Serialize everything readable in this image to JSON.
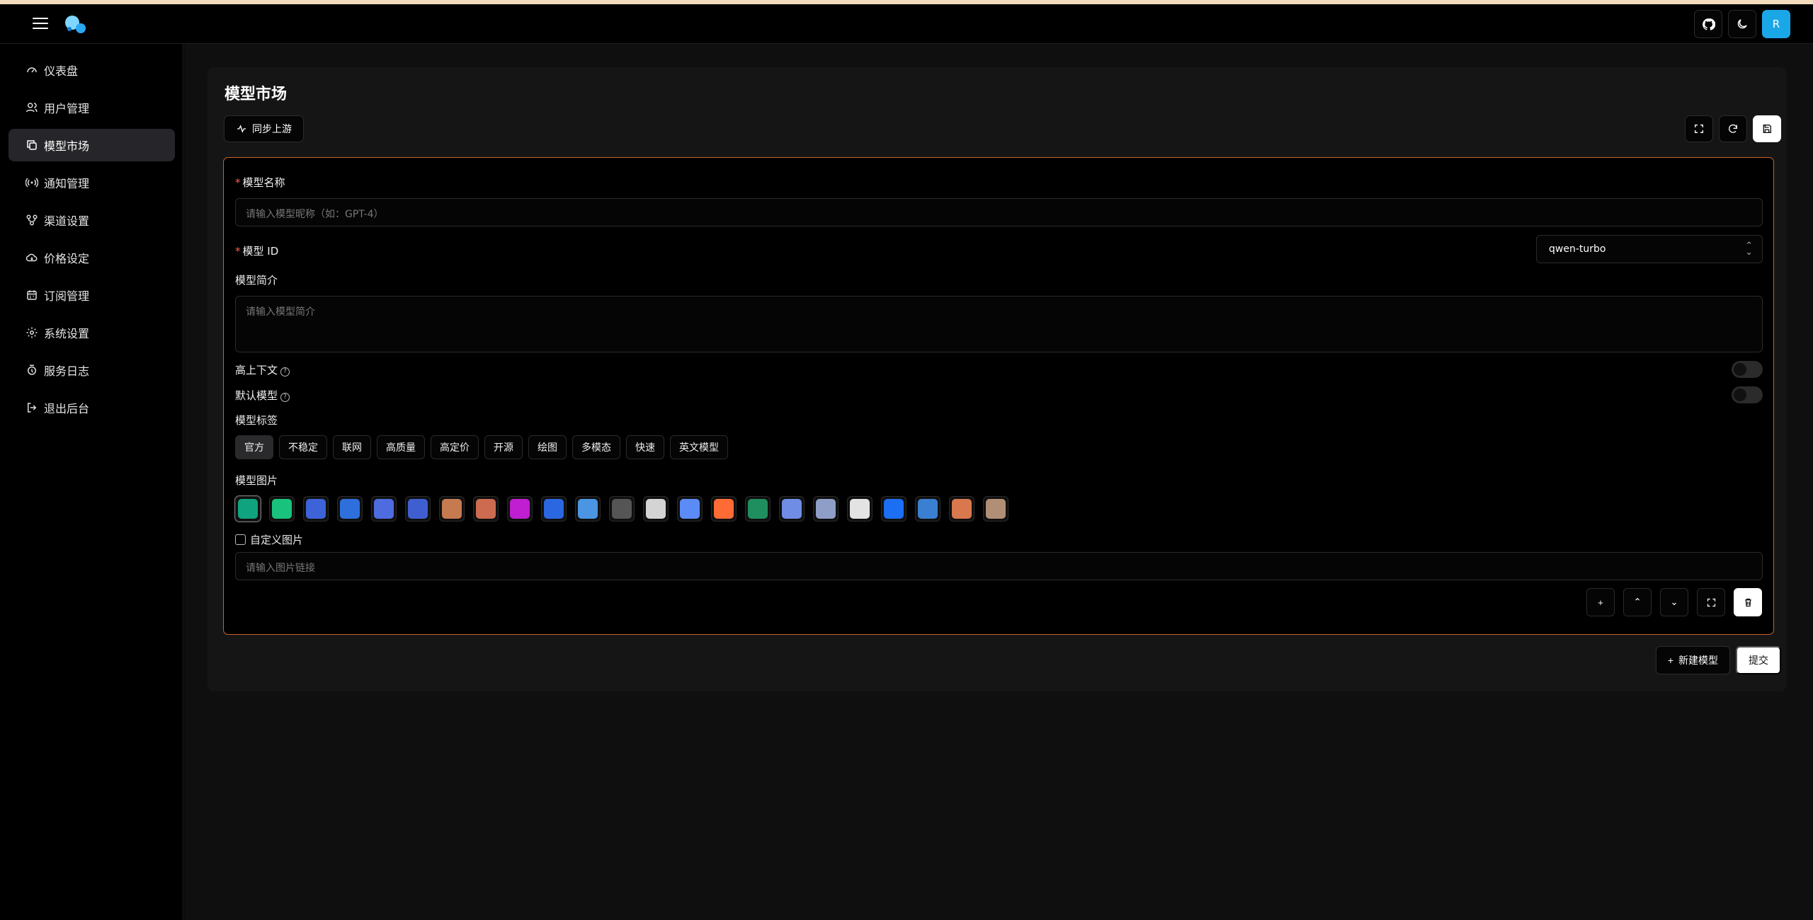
{
  "header": {
    "github": "github-icon",
    "theme": "moon-icon",
    "avatar": "R"
  },
  "sidebar": {
    "items": [
      {
        "label": "仪表盘",
        "icon": "dashboard-icon"
      },
      {
        "label": "用户管理",
        "icon": "users-icon"
      },
      {
        "label": "模型市场",
        "icon": "copy-icon",
        "active": true
      },
      {
        "label": "通知管理",
        "icon": "broadcast-icon"
      },
      {
        "label": "渠道设置",
        "icon": "branch-icon"
      },
      {
        "label": "价格设定",
        "icon": "cloud-icon"
      },
      {
        "label": "订阅管理",
        "icon": "calendar-icon"
      },
      {
        "label": "系统设置",
        "icon": "gear-icon"
      },
      {
        "label": "服务日志",
        "icon": "log-icon"
      },
      {
        "label": "退出后台",
        "icon": "logout-icon"
      }
    ]
  },
  "main": {
    "title": "模型市场",
    "sync_button": "同步上游",
    "form": {
      "model_name_label": "模型名称",
      "model_name_placeholder": "请输入模型昵称（如：GPT-4）",
      "model_id_label": "模型 ID",
      "model_id_value": "qwen-turbo",
      "description_label": "模型简介",
      "description_placeholder": "请输入模型简介",
      "high_context_label": "高上下文",
      "default_model_label": "默认模型",
      "tags_label": "模型标签",
      "tags": [
        "官方",
        "不稳定",
        "联网",
        "高质量",
        "高定价",
        "开源",
        "绘图",
        "多模态",
        "快速",
        "英文模型"
      ],
      "images_label": "模型图片",
      "image_colors": [
        "#10a37f",
        "#19c37d",
        "#3c64d8",
        "#2f6fdb",
        "#4e6ce0",
        "#3f5fd1",
        "#c67a50",
        "#cc6b4f",
        "#bf1fd0",
        "#2a67e0",
        "#4b95e2",
        "#555555",
        "#d4d4d4",
        "#5b8bf7",
        "#ff6b35",
        "#1f8f5f",
        "#6f8de5",
        "#8f9ec7",
        "#e3e3e3",
        "#1c6ef2",
        "#3a7fd1",
        "#d9774f",
        "#b08f76"
      ],
      "custom_image_label": "自定义图片",
      "image_url_placeholder": "请输入图片链接"
    },
    "new_model_button": "新建模型",
    "submit_button": "提交"
  }
}
